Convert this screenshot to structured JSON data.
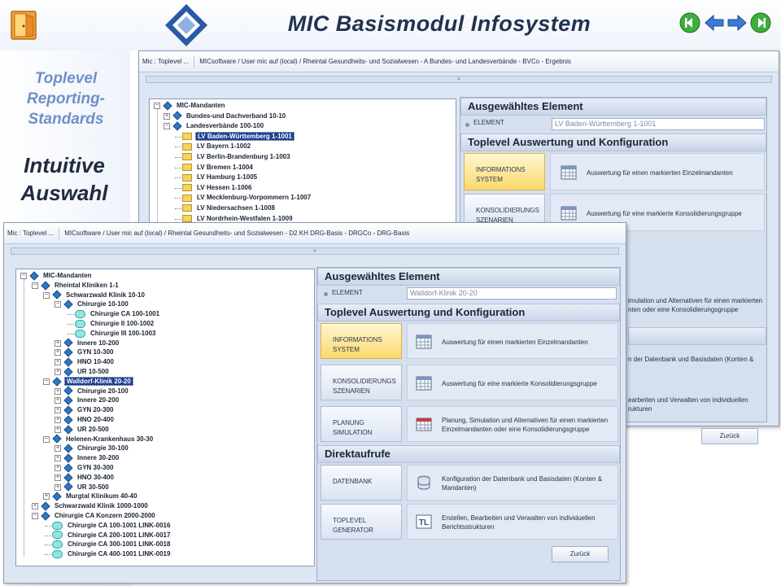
{
  "slide": {
    "title": "MIC  Basismodul Infosystem",
    "sidebar_subtitle": "Toplevel Reporting-Standards",
    "sidebar_heading": "Intuitive Auswahl",
    "nav_icons": [
      "first-icon",
      "back-icon",
      "forward-icon",
      "last-icon"
    ]
  },
  "back_window": {
    "title_left": "Mic : Toplevel ...",
    "title_path": "MICsoftware / User mic auf  (local) / Rheintal Gesundheits- und Sozialwesen - A Bundes- und Landesverbände - BVCo - Ergebnis",
    "collapse": "≈",
    "tree": [
      {
        "label": "MIC-Mandanten",
        "icon": "diamond-icon",
        "expander": "−"
      },
      {
        "label": "Bundes-und Dachverband 10-10",
        "icon": "diamond-icon",
        "expander": "+"
      },
      {
        "label": "Landesverbände 100-100",
        "icon": "diamond-icon",
        "expander": "−"
      },
      {
        "label": "LV Baden-Württemberg 1-1001",
        "icon": "folder-icon",
        "selected": true
      },
      {
        "label": "LV Bayern 1-1002",
        "icon": "folder-icon"
      },
      {
        "label": "LV Berlin-Brandenburg 1-1003",
        "icon": "folder-icon"
      },
      {
        "label": "LV Bremen 1-1004",
        "icon": "folder-icon"
      },
      {
        "label": "LV Hamburg 1-1005",
        "icon": "folder-icon"
      },
      {
        "label": "LV Hessen 1-1006",
        "icon": "folder-icon"
      },
      {
        "label": "LV Mecklenburg-Vorpommern 1-1007",
        "icon": "folder-icon"
      },
      {
        "label": "LV Niedersachsen 1-1008",
        "icon": "folder-icon"
      },
      {
        "label": "LV Nordrhein-Westfalen 1-1009",
        "icon": "folder-icon"
      }
    ],
    "selected_heading": "Ausgewähltes Element",
    "element_label": "ELEMENT",
    "element_value": "LV Baden-Württemberg 1-1001",
    "config_heading": "Toplevel Auswertung und Konfiguration",
    "buttons": [
      {
        "label": "INFORMATIONS SYSTEM",
        "desc": "Auswertung für einen markierten Einzelmandanten"
      },
      {
        "label": "KONSOLIDIERUNGS SZENARIEN",
        "desc": "Auswertung für eine markierte Konsolidierungsgruppe"
      }
    ],
    "partial_texts": [
      "imulation und Alternativen für einen markierten",
      "nten oder eine Konsolidierungsgruppe",
      "n der Datenbank und Basisdaten (Konten &",
      "earbeiten und Verwalten von individuellen",
      "rukturen"
    ],
    "back_label": "Zurück"
  },
  "front_window": {
    "title_left": "Mic : Toplevel ...",
    "title_path": "MICsoftware / User mic auf  (local) / Rheintal Gesundheits- und Sozialwesen - D2 KH DRG-Basis - DRGCo - DRG-Basis",
    "collapse": "≈",
    "tree": [
      {
        "label": "MIC-Mandanten",
        "depth": 0,
        "icon": "diamond-icon",
        "expander": "−"
      },
      {
        "label": "Rheintal Kliniken 1-1",
        "depth": 1,
        "icon": "diamond-icon",
        "expander": "−"
      },
      {
        "label": "Schwarzwald Klinik 10-10",
        "depth": 2,
        "icon": "diamond-icon",
        "expander": "−"
      },
      {
        "label": "Chirurgie 10-100",
        "depth": 3,
        "icon": "diamond-icon",
        "expander": "−"
      },
      {
        "label": "Chirurgie CA 100-1001",
        "depth": 4,
        "icon": "cluster-icon"
      },
      {
        "label": "Chirurgie II 100-1002",
        "depth": 4,
        "icon": "cluster-icon"
      },
      {
        "label": "Chirurgie III 100-1003",
        "depth": 4,
        "icon": "cluster-icon"
      },
      {
        "label": "Innere 10-200",
        "depth": 3,
        "icon": "diamond-icon",
        "expander": "+"
      },
      {
        "label": "GYN 10-300",
        "depth": 3,
        "icon": "diamond-icon",
        "expander": "+"
      },
      {
        "label": "HNO 10-400",
        "depth": 3,
        "icon": "diamond-icon",
        "expander": "+"
      },
      {
        "label": "UR 10-500",
        "depth": 3,
        "icon": "diamond-icon",
        "expander": "+"
      },
      {
        "label": "Walldorf-Klinik 20-20",
        "depth": 2,
        "icon": "diamond-icon",
        "expander": "−",
        "selected": true
      },
      {
        "label": "Chirurgie 20-100",
        "depth": 3,
        "icon": "diamond-icon",
        "expander": "+"
      },
      {
        "label": "Innere 20-200",
        "depth": 3,
        "icon": "diamond-icon",
        "expander": "+"
      },
      {
        "label": "GYN 20-300",
        "depth": 3,
        "icon": "diamond-icon",
        "expander": "+"
      },
      {
        "label": "HNO 20-400",
        "depth": 3,
        "icon": "diamond-icon",
        "expander": "+"
      },
      {
        "label": "UR 20-500",
        "depth": 3,
        "icon": "diamond-icon",
        "expander": "+"
      },
      {
        "label": "Helenen-Krankenhaus 30-30",
        "depth": 2,
        "icon": "diamond-icon",
        "expander": "−"
      },
      {
        "label": "Chirurgie 30-100",
        "depth": 3,
        "icon": "diamond-icon",
        "expander": "+"
      },
      {
        "label": "Innere 30-200",
        "depth": 3,
        "icon": "diamond-icon",
        "expander": "+"
      },
      {
        "label": "GYN 30-300",
        "depth": 3,
        "icon": "diamond-icon",
        "expander": "+"
      },
      {
        "label": "HNO 30-400",
        "depth": 3,
        "icon": "diamond-icon",
        "expander": "+"
      },
      {
        "label": "UR 30-500",
        "depth": 3,
        "icon": "diamond-icon",
        "expander": "+"
      },
      {
        "label": "Murgtal Klinikum 40-40",
        "depth": 2,
        "icon": "diamond-icon",
        "expander": "+"
      },
      {
        "label": "Schwarzwald Klinik 1000-1000",
        "depth": 1,
        "icon": "diamond-icon",
        "expander": "+"
      },
      {
        "label": "Chirurgie CA Konzern 2000-2000",
        "depth": 1,
        "icon": "diamond-icon",
        "expander": "−"
      },
      {
        "label": "Chirurgie CA 100-1001 LINK-0016",
        "depth": 2,
        "icon": "cluster-icon"
      },
      {
        "label": "Chirurgie CA 200-1001 LINK-0017",
        "depth": 2,
        "icon": "cluster-icon"
      },
      {
        "label": "Chirurgie CA 300-1001 LINK-0018",
        "depth": 2,
        "icon": "cluster-icon"
      },
      {
        "label": "Chirurgie CA 400-1001 LINK-0019",
        "depth": 2,
        "icon": "cluster-icon"
      }
    ],
    "selected_heading": "Ausgewähltes Element",
    "element_label": "ELEMENT",
    "element_value": "Walldorf-Klinik 20-20",
    "config_heading": "Toplevel Auswertung und Konfiguration",
    "direct_heading": "Direktaufrufe",
    "buttons": [
      {
        "label": "INFORMATIONS SYSTEM",
        "desc": "Auswertung für einen markierten Einzelmandanten",
        "icon": "grid-icon",
        "active": true
      },
      {
        "label": "KONSOLIDIERUNGS SZENARIEN",
        "desc": "Auswertung für eine markierte Konsolidierungsgruppe",
        "icon": "grid-icon"
      },
      {
        "label": "PLANUNG SIMULATION",
        "desc": "Planung, Simulation und Alternativen für einen markierten Einzelmandanten oder eine Konsolidierungsgruppe",
        "icon": "calendar-icon"
      },
      {
        "label": "DATENBANK",
        "desc": "Konfiguration der Datenbank und Basisdaten (Konten & Mandanten)",
        "icon": "database-icon"
      },
      {
        "label": "TOPLEVEL GENERATOR",
        "desc": "Erstellen, Bearbeiten und Verwalten von individuellen Berichtsstrukturen",
        "icon": "tl-icon"
      }
    ],
    "back_label": "Zurück"
  },
  "colors": {
    "title": "#22324f",
    "subtitle": "#6f8fc8",
    "active_button": "#fbd96d",
    "tree_selection": "#1d3f8f"
  }
}
